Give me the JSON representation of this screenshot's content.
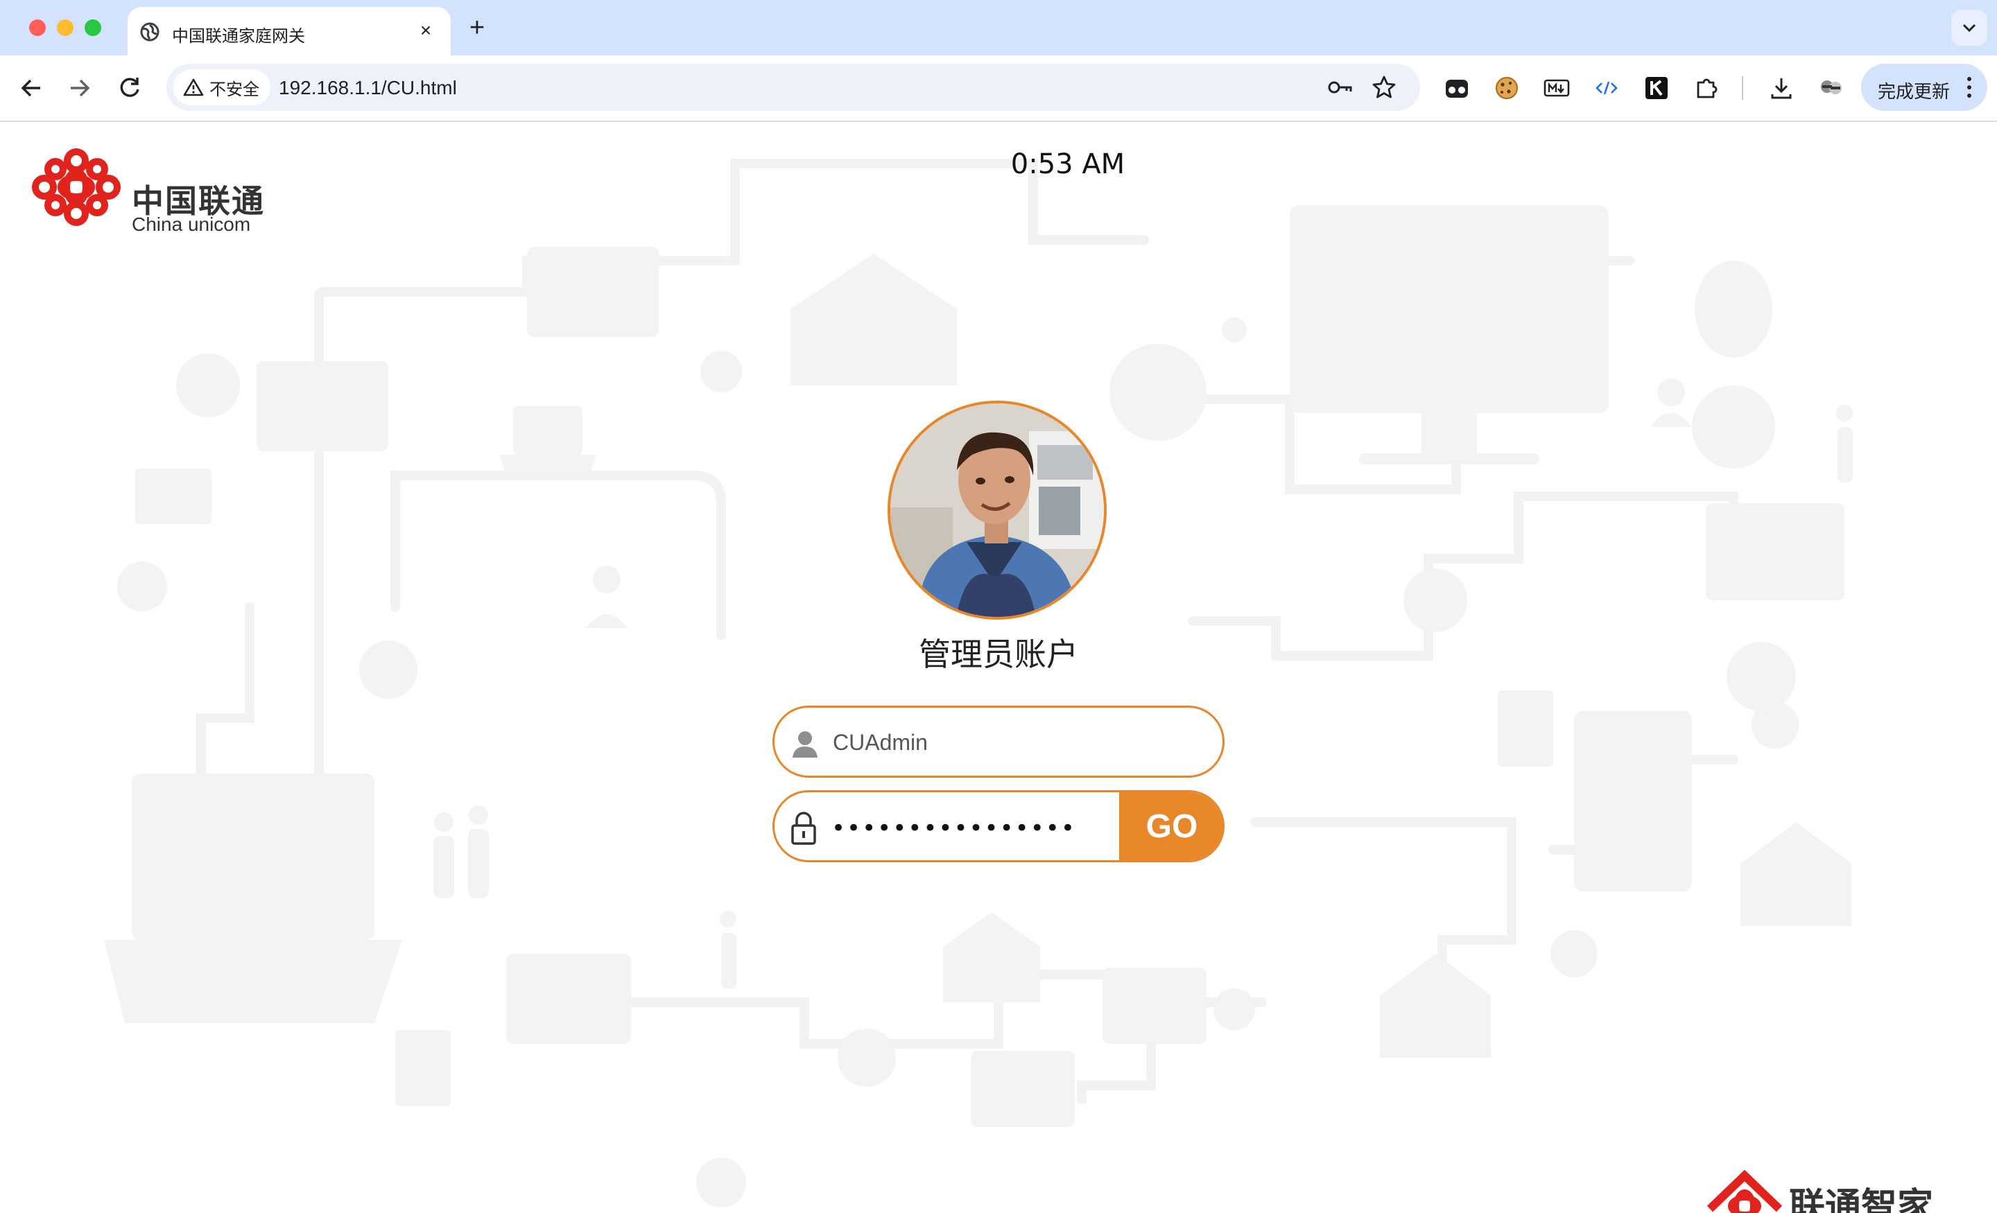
{
  "browser": {
    "tab": {
      "title": "中国联通家庭网关",
      "close": "×"
    },
    "new_tab": "+",
    "address": {
      "security_label": "不安全",
      "url": "192.168.1.1/CU.html"
    },
    "update_button": "完成更新",
    "icons": {
      "back": "back-arrow-icon",
      "forward": "forward-arrow-icon",
      "reload": "reload-icon",
      "key": "password-key-icon",
      "bookmark": "star-icon",
      "extensions": [
        "incognito-icon",
        "cookie-icon",
        "markdown-icon",
        "code-icon",
        "k-icon",
        "puzzle-icon",
        "download-icon",
        "profile-icon"
      ]
    }
  },
  "page": {
    "brand": {
      "cn": "中国联通",
      "en": "China unicom",
      "color": "#e0231d"
    },
    "clock": "0:53 AM",
    "account_title": "管理员账户",
    "username": {
      "value": "CUAdmin"
    },
    "password": {
      "value": "••••••••••••••••"
    },
    "go_label": "GO",
    "bottom_brand": "联通智家",
    "accent_color": "#e8862a"
  }
}
